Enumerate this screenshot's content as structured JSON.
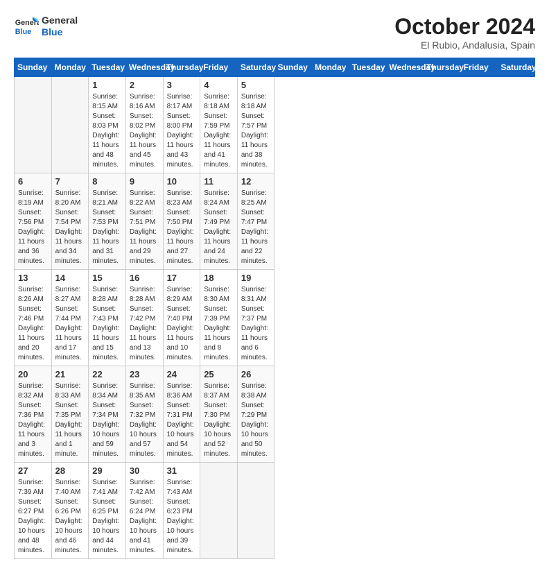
{
  "header": {
    "logo_line1": "General",
    "logo_line2": "Blue",
    "month": "October 2024",
    "location": "El Rubio, Andalusia, Spain"
  },
  "days_of_week": [
    "Sunday",
    "Monday",
    "Tuesday",
    "Wednesday",
    "Thursday",
    "Friday",
    "Saturday"
  ],
  "weeks": [
    [
      {
        "day": "",
        "empty": true
      },
      {
        "day": "",
        "empty": true
      },
      {
        "day": "1",
        "sunrise": "8:15 AM",
        "sunset": "8:03 PM",
        "daylight": "11 hours and 48 minutes."
      },
      {
        "day": "2",
        "sunrise": "8:16 AM",
        "sunset": "8:02 PM",
        "daylight": "11 hours and 45 minutes."
      },
      {
        "day": "3",
        "sunrise": "8:17 AM",
        "sunset": "8:00 PM",
        "daylight": "11 hours and 43 minutes."
      },
      {
        "day": "4",
        "sunrise": "8:18 AM",
        "sunset": "7:59 PM",
        "daylight": "11 hours and 41 minutes."
      },
      {
        "day": "5",
        "sunrise": "8:18 AM",
        "sunset": "7:57 PM",
        "daylight": "11 hours and 38 minutes."
      }
    ],
    [
      {
        "day": "6",
        "sunrise": "8:19 AM",
        "sunset": "7:56 PM",
        "daylight": "11 hours and 36 minutes."
      },
      {
        "day": "7",
        "sunrise": "8:20 AM",
        "sunset": "7:54 PM",
        "daylight": "11 hours and 34 minutes."
      },
      {
        "day": "8",
        "sunrise": "8:21 AM",
        "sunset": "7:53 PM",
        "daylight": "11 hours and 31 minutes."
      },
      {
        "day": "9",
        "sunrise": "8:22 AM",
        "sunset": "7:51 PM",
        "daylight": "11 hours and 29 minutes."
      },
      {
        "day": "10",
        "sunrise": "8:23 AM",
        "sunset": "7:50 PM",
        "daylight": "11 hours and 27 minutes."
      },
      {
        "day": "11",
        "sunrise": "8:24 AM",
        "sunset": "7:49 PM",
        "daylight": "11 hours and 24 minutes."
      },
      {
        "day": "12",
        "sunrise": "8:25 AM",
        "sunset": "7:47 PM",
        "daylight": "11 hours and 22 minutes."
      }
    ],
    [
      {
        "day": "13",
        "sunrise": "8:26 AM",
        "sunset": "7:46 PM",
        "daylight": "11 hours and 20 minutes."
      },
      {
        "day": "14",
        "sunrise": "8:27 AM",
        "sunset": "7:44 PM",
        "daylight": "11 hours and 17 minutes."
      },
      {
        "day": "15",
        "sunrise": "8:28 AM",
        "sunset": "7:43 PM",
        "daylight": "11 hours and 15 minutes."
      },
      {
        "day": "16",
        "sunrise": "8:28 AM",
        "sunset": "7:42 PM",
        "daylight": "11 hours and 13 minutes."
      },
      {
        "day": "17",
        "sunrise": "8:29 AM",
        "sunset": "7:40 PM",
        "daylight": "11 hours and 10 minutes."
      },
      {
        "day": "18",
        "sunrise": "8:30 AM",
        "sunset": "7:39 PM",
        "daylight": "11 hours and 8 minutes."
      },
      {
        "day": "19",
        "sunrise": "8:31 AM",
        "sunset": "7:37 PM",
        "daylight": "11 hours and 6 minutes."
      }
    ],
    [
      {
        "day": "20",
        "sunrise": "8:32 AM",
        "sunset": "7:36 PM",
        "daylight": "11 hours and 3 minutes."
      },
      {
        "day": "21",
        "sunrise": "8:33 AM",
        "sunset": "7:35 PM",
        "daylight": "11 hours and 1 minute."
      },
      {
        "day": "22",
        "sunrise": "8:34 AM",
        "sunset": "7:34 PM",
        "daylight": "10 hours and 59 minutes."
      },
      {
        "day": "23",
        "sunrise": "8:35 AM",
        "sunset": "7:32 PM",
        "daylight": "10 hours and 57 minutes."
      },
      {
        "day": "24",
        "sunrise": "8:36 AM",
        "sunset": "7:31 PM",
        "daylight": "10 hours and 54 minutes."
      },
      {
        "day": "25",
        "sunrise": "8:37 AM",
        "sunset": "7:30 PM",
        "daylight": "10 hours and 52 minutes."
      },
      {
        "day": "26",
        "sunrise": "8:38 AM",
        "sunset": "7:29 PM",
        "daylight": "10 hours and 50 minutes."
      }
    ],
    [
      {
        "day": "27",
        "sunrise": "7:39 AM",
        "sunset": "6:27 PM",
        "daylight": "10 hours and 48 minutes."
      },
      {
        "day": "28",
        "sunrise": "7:40 AM",
        "sunset": "6:26 PM",
        "daylight": "10 hours and 46 minutes."
      },
      {
        "day": "29",
        "sunrise": "7:41 AM",
        "sunset": "6:25 PM",
        "daylight": "10 hours and 44 minutes."
      },
      {
        "day": "30",
        "sunrise": "7:42 AM",
        "sunset": "6:24 PM",
        "daylight": "10 hours and 41 minutes."
      },
      {
        "day": "31",
        "sunrise": "7:43 AM",
        "sunset": "6:23 PM",
        "daylight": "10 hours and 39 minutes."
      },
      {
        "day": "",
        "empty": true
      },
      {
        "day": "",
        "empty": true
      }
    ]
  ],
  "labels": {
    "sunrise_prefix": "Sunrise: ",
    "sunset_prefix": "Sunset: ",
    "daylight_prefix": "Daylight: "
  }
}
